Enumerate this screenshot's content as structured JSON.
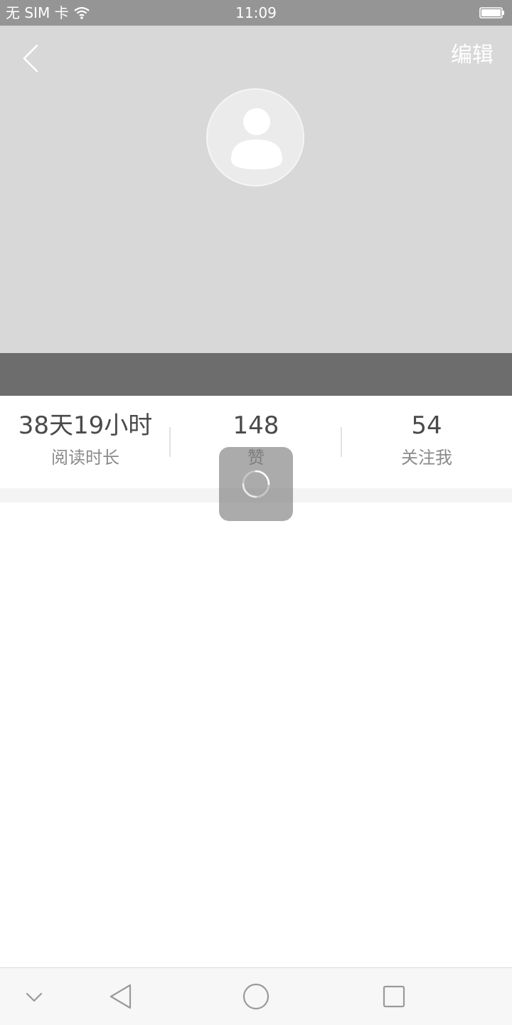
{
  "status_bar": {
    "carrier": "无 SIM 卡",
    "time": "11:09",
    "wifi_icon": "wifi-icon",
    "battery_icon": "battery-icon"
  },
  "header": {
    "back_icon": "chevron-left-icon",
    "edit_label": "编辑",
    "avatar_icon": "default-user-avatar-icon"
  },
  "stats": [
    {
      "value": "38天19小时",
      "label": "阅读时长"
    },
    {
      "value": "148",
      "label": "赞"
    },
    {
      "value": "54",
      "label": "关注我"
    }
  ],
  "loading": {
    "icon": "spinner-icon"
  },
  "nav_bar": {
    "items": [
      "chevron-down-icon",
      "back-triangle-icon",
      "home-circle-icon",
      "recents-square-icon"
    ]
  },
  "colors": {
    "status_bar_bg": "#959595",
    "header_bg": "#d8d8d8",
    "band_bg": "#6d6d6d",
    "toast_bg": "#787878"
  }
}
